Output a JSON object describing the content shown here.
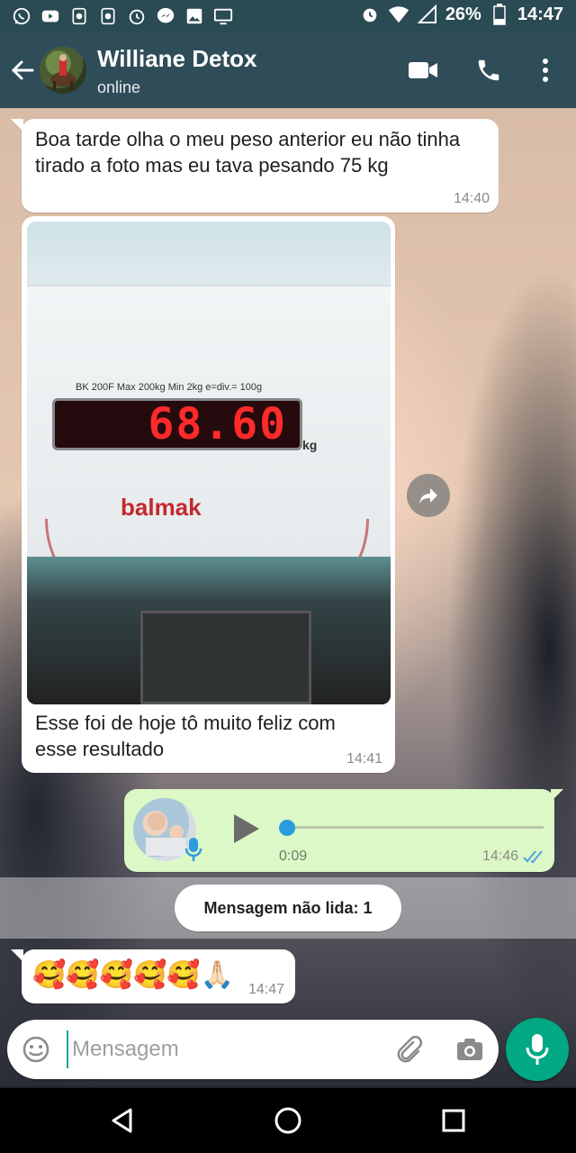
{
  "status_bar": {
    "battery": "26%",
    "time": "14:47",
    "left_icons": [
      "whatsapp-icon",
      "youtube-icon",
      "nfc-icon",
      "nfc-icon",
      "alarm-icon",
      "messenger-icon",
      "gallery-icon",
      "cast-icon"
    ],
    "right_icons": [
      "alarm-icon",
      "wifi-icon",
      "signal-icon",
      "battery-icon"
    ]
  },
  "header": {
    "contact_name": "Williane Detox",
    "status": "online",
    "icons": [
      "back-arrow-icon",
      "video-call-icon",
      "phone-icon",
      "more-vert-icon"
    ]
  },
  "messages": [
    {
      "direction": "in",
      "text": "Boa tarde olha o meu peso anterior eu não tinha tirado a foto mas eu tava pesando 75 kg",
      "time": "14:40"
    },
    {
      "direction": "in",
      "type": "image",
      "image_display": "68.60",
      "image_brand": "balmak",
      "image_spec": "BK 200F   Max 200kg   Min 2kg   e=div.= 100g",
      "image_unit": "kg",
      "caption": "Esse foi de hoje tô muito feliz com esse resultado",
      "time": "14:41"
    },
    {
      "direction": "out",
      "type": "audio",
      "duration": "0:09",
      "time": "14:46",
      "ticks": "read"
    },
    {
      "direction": "in",
      "text": "🥰🥰🥰🥰🥰🙏🏻",
      "time": "14:47"
    }
  ],
  "unread_banner": "Mensagem não lida: 1",
  "input": {
    "placeholder": "Mensagem",
    "value": ""
  },
  "colors": {
    "header": "#2f4d59",
    "outgoing_bubble": "#dcf8c6",
    "accent_green": "#00a884",
    "read_ticks": "#4fa3e0"
  }
}
